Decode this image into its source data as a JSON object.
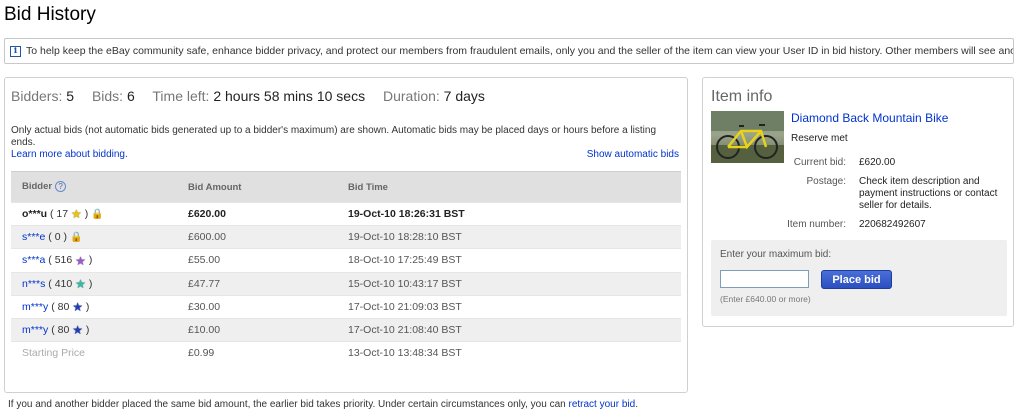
{
  "page": {
    "title": "Bid History"
  },
  "info_bar": {
    "text": "To help keep the eBay community safe, enhance bidder privacy, and protect our members from fraudulent emails, only you and the seller of the item can view your User ID in bid history. Other members will see anonymous names."
  },
  "summary": {
    "bidders_label": "Bidders:",
    "bidders_value": "5",
    "bids_label": "Bids:",
    "bids_value": "6",
    "time_left_label": "Time left:",
    "time_left_value": "2 hours 58 mins 10 secs",
    "duration_label": "Duration:",
    "duration_value": "7 days"
  },
  "note": {
    "text": "Only actual bids (not automatic bids generated up to a bidder's maximum) are shown. Automatic bids may be placed days or hours before a listing ends.",
    "link": "Learn more about bidding."
  },
  "show_automatic_bids": "Show automatic bids",
  "table": {
    "headers": {
      "bidder": "Bidder",
      "help": "?",
      "amount": "Bid Amount",
      "time": "Bid Time"
    },
    "rows": [
      {
        "bidder": "o***u",
        "count": "( 17",
        "close": ")",
        "star_color": "#f0c400",
        "lock": true,
        "amount": "£620.00",
        "time": "19-Oct-10 18:26:31 BST"
      },
      {
        "bidder": "s***e",
        "count": "( 0 )",
        "close": "",
        "star_color": "",
        "lock": true,
        "amount": "£600.00",
        "time": "19-Oct-10 18:28:10 BST"
      },
      {
        "bidder": "s***a",
        "count": "( 516",
        "close": ")",
        "star_color": "#9b59d0",
        "lock": false,
        "amount": "£55.00",
        "time": "18-Oct-10 17:25:49 BST"
      },
      {
        "bidder": "n***s",
        "count": "( 410",
        "close": ")",
        "star_color": "#2fbfa8",
        "lock": false,
        "amount": "£47.77",
        "time": "15-Oct-10 10:43:17 BST"
      },
      {
        "bidder": "m***y",
        "count": "( 80",
        "close": ")",
        "star_color": "#1f3fbf",
        "lock": false,
        "amount": "£30.00",
        "time": "17-Oct-10 21:09:03 BST"
      },
      {
        "bidder": "m***y",
        "count": "( 80",
        "close": ")",
        "star_color": "#1f3fbf",
        "lock": false,
        "amount": "£10.00",
        "time": "17-Oct-10 21:08:40 BST"
      }
    ],
    "starting": {
      "label": "Starting Price",
      "amount": "£0.99",
      "time": "13-Oct-10 13:48:34 BST"
    }
  },
  "footer": {
    "text": "If you and another bidder placed the same bid amount, the earlier bid takes priority. Under certain circumstances only, you can",
    "link": "retract your bid",
    "end": "."
  },
  "item_info": {
    "title": "Item info",
    "item_title": "Diamond Back Mountain Bike",
    "reserve": "Reserve met",
    "current_bid_label": "Current bid:",
    "current_bid_value": "£620.00",
    "postage_label": "Postage:",
    "postage_value": "Check item description and payment instructions or contact seller for details.",
    "item_number_label": "Item number:",
    "item_number_value": "220682492607",
    "bid_prompt": "Enter your maximum bid:",
    "bid_input_value": "",
    "place_bid_label": "Place bid",
    "bid_hint": "(Enter £640.00 or more)"
  },
  "icons": {
    "info": "info-icon",
    "help": "help-icon",
    "star": "feedback-star-icon",
    "lock": "padlock-icon"
  }
}
